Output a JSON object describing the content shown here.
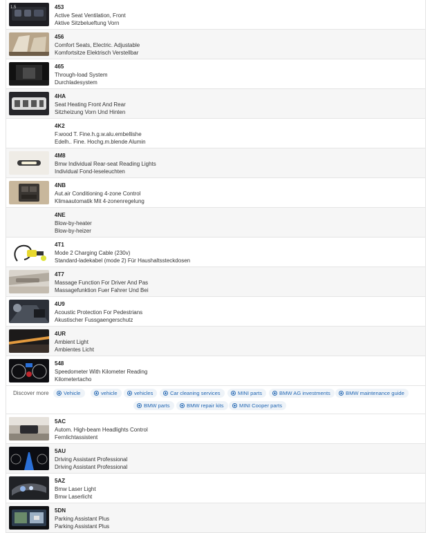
{
  "options_top": [
    {
      "code": "453",
      "line1": "Active Seat Ventilation, Front",
      "line2": "Aktive Sitzbelueftung Vorn",
      "icon": "seat-ventilation-thumbnail"
    },
    {
      "code": "456",
      "line1": "Comfort Seats, Electric. Adjustable",
      "line2": "Komfortsitze Elektrisch Verstellbar",
      "icon": "comfort-seats-thumbnail"
    },
    {
      "code": "465",
      "line1": "Through-load System",
      "line2": "Durchladesystem",
      "icon": "through-load-thumbnail"
    },
    {
      "code": "4HA",
      "line1": "Seat Heating Front And Rear",
      "line2": "Sitzheizung Vorn Und Hinten",
      "icon": "seat-heating-thumbnail"
    },
    {
      "code": "4K2",
      "line1": "F.wood T. Fine.h.g.w.alu.embellishe",
      "line2": "Edelh.. Fine. Hochg.m.blende Alumin",
      "icon": ""
    },
    {
      "code": "4M8",
      "line1": "Bmw Individual Rear-seat Reading Lights",
      "line2": "Individual Fond-leseleuchten",
      "icon": "reading-lights-thumbnail"
    },
    {
      "code": "4NB",
      "line1": "Aut.air Conditioning 4-zone Control",
      "line2": "Klimaautomatik Mit 4-zonenregelung",
      "icon": "air-conditioning-thumbnail"
    },
    {
      "code": "4NE",
      "line1": "Blow-by-heater",
      "line2": "Blow-by-heizer",
      "icon": ""
    },
    {
      "code": "4T1",
      "line1": "Mode 2 Charging Cable (230v)",
      "line2": "Standard-ladekabel (mode 2) Für Haushaltssteckdosen",
      "icon": "charging-cable-thumbnail"
    },
    {
      "code": "4T7",
      "line1": "Massage Function For Driver And Pas",
      "line2": "Massagefunktion Fuer Fahrer Und Bei",
      "icon": "massage-thumbnail"
    },
    {
      "code": "4U9",
      "line1": "Acoustic Protection For Pedestrians",
      "line2": "Akustischer Fussgaengerschutz",
      "icon": "acoustic-protection-thumbnail"
    },
    {
      "code": "4UR",
      "line1": "Ambient Light",
      "line2": "Ambientes Licht",
      "icon": "ambient-light-thumbnail"
    },
    {
      "code": "548",
      "line1": "Speedometer With Kilometer Reading",
      "line2": "Kilometertacho",
      "icon": "speedometer-thumbnail"
    }
  ],
  "discover": {
    "label": "Discover more",
    "links": [
      "Vehicle",
      "vehicle",
      "vehicles",
      "Car cleaning services",
      "MINI parts",
      "BMW AG investments",
      "BMW maintenance guide",
      "BMW parts",
      "BMW repair kits",
      "MINI Cooper parts"
    ]
  },
  "options_bottom": [
    {
      "code": "5AC",
      "line1": "Autom. High-beam Headlights Control",
      "line2": "Fernlichtassistent",
      "icon": "high-beam-thumbnail"
    },
    {
      "code": "5AU",
      "line1": "Driving Assistant Professional",
      "line2": "Driving Assistant Professional",
      "icon": "driving-assistant-thumbnail"
    },
    {
      "code": "5AZ",
      "line1": "Bmw Laser Light",
      "line2": "Bmw Laserlicht",
      "icon": "laser-light-thumbnail"
    },
    {
      "code": "5DN",
      "line1": "Parking Assistant Plus",
      "line2": "Parking Assistant Plus",
      "icon": "parking-assistant-thumbnail"
    }
  ],
  "colors": {
    "link": "#2367b3",
    "pill_bg": "#eef3f8",
    "row_alt": "#f6f6f6",
    "border": "#e4e4e4"
  }
}
